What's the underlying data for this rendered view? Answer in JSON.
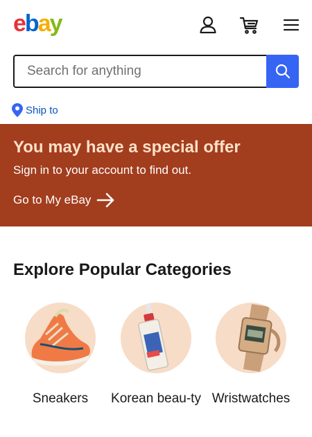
{
  "header": {
    "logo": {
      "e": "e",
      "b": "b",
      "a": "a",
      "y": "y"
    },
    "icons": [
      "user-icon",
      "cart-icon",
      "hamburger-menu-icon"
    ]
  },
  "search": {
    "placeholder": "Search for anything",
    "value": ""
  },
  "ship_to": {
    "label": "Ship to"
  },
  "banner": {
    "title": "You may have a special offer",
    "subtitle": "Sign in to your account to find out.",
    "link_label": "Go to My eBay"
  },
  "categories": {
    "title": "Explore Popular Categories",
    "items": [
      {
        "label": "Sneakers"
      },
      {
        "label": "Korean beau-ty"
      },
      {
        "label": "Wristwatches"
      }
    ]
  },
  "colors": {
    "banner_bg": "#a23d1e",
    "search_button": "#3665f3",
    "link": "#0654ba",
    "category_circle": "#f7dcc7"
  }
}
